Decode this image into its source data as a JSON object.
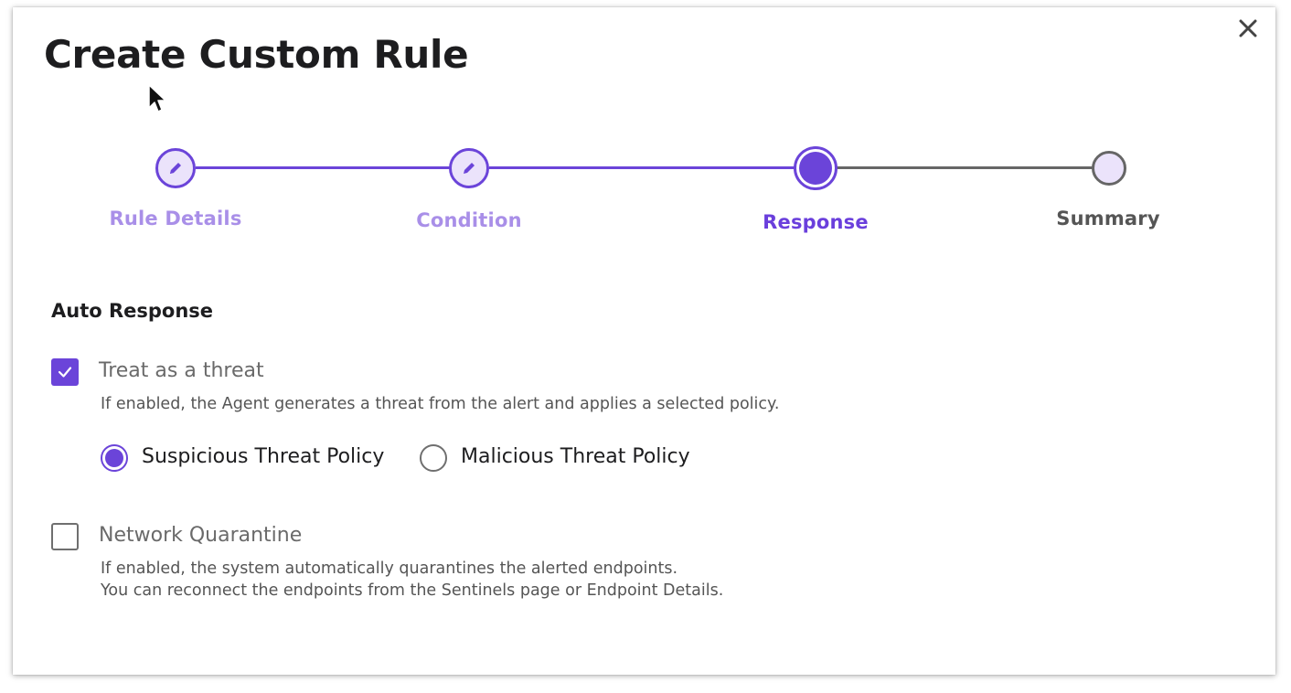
{
  "dialog": {
    "title": "Create Custom Rule",
    "close_icon": "close-icon"
  },
  "stepper": {
    "steps": [
      {
        "label": "Rule Details",
        "state": "completed",
        "icon": "pencil-icon"
      },
      {
        "label": "Condition",
        "state": "completed",
        "icon": "pencil-icon"
      },
      {
        "label": "Response",
        "state": "current"
      },
      {
        "label": "Summary",
        "state": "upcoming"
      }
    ]
  },
  "auto_response": {
    "title": "Auto Response",
    "treat_as_threat": {
      "label": "Treat as a threat",
      "checked": true,
      "description": "If enabled, the Agent generates a threat from the alert and applies a selected policy.",
      "policies": [
        {
          "label": "Suspicious Threat Policy",
          "selected": true
        },
        {
          "label": "Malicious Threat Policy",
          "selected": false
        }
      ]
    },
    "network_quarantine": {
      "label": "Network Quarantine",
      "checked": false,
      "description_line1": "If enabled, the system automatically quarantines the alerted endpoints.",
      "description_line2": "You can reconnect the endpoints from the Sentinels page or Endpoint Details."
    }
  },
  "colors": {
    "accent": "#6b44d9",
    "completed_label": "#a98fe8",
    "upcoming": "#666666"
  }
}
